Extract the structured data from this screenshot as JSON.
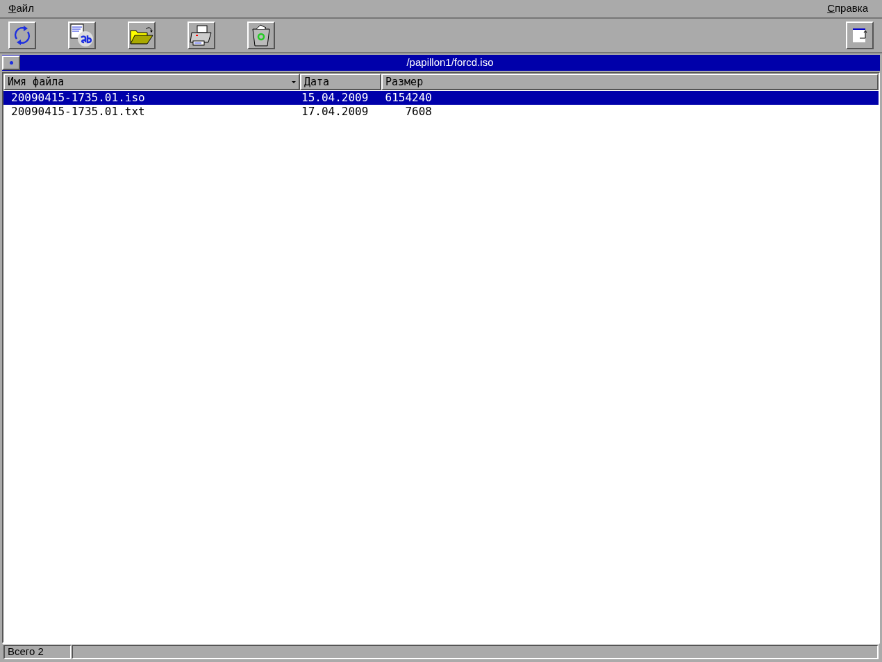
{
  "menu": {
    "left": "Файл",
    "right": "Справка"
  },
  "toolbar": {
    "buttons": [
      {
        "kind": "refresh"
      },
      {
        "kind": "rename"
      },
      {
        "kind": "open"
      },
      {
        "kind": "print"
      },
      {
        "kind": "trash"
      }
    ],
    "right_button": {
      "kind": "window"
    }
  },
  "path_bar": {
    "title": "/papillon1/forcd.iso"
  },
  "table": {
    "columns": [
      {
        "label": "Имя файла",
        "sorted": true
      },
      {
        "label": "Дата",
        "sorted": false
      },
      {
        "label": "Размер",
        "sorted": false
      }
    ],
    "rows": [
      {
        "name": "20090415-1735.01.iso",
        "date": "15.04.2009",
        "size": "6154240",
        "selected": true
      },
      {
        "name": "20090415-1735.01.txt",
        "date": "17.04.2009",
        "size": "7608",
        "selected": false
      }
    ]
  },
  "status_bar": {
    "text": "Всего 2"
  }
}
